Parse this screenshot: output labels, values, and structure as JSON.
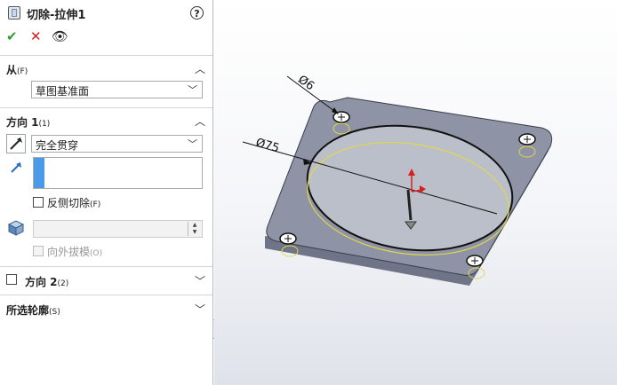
{
  "feature": {
    "title": "切除-拉伸1",
    "help_glyph": "?",
    "ok_glyph": "✔",
    "cancel_glyph": "✕",
    "preview_glyph": "👁"
  },
  "from": {
    "label": "从",
    "shortcut": "(F)",
    "value": "草图基准面"
  },
  "direction1": {
    "label": "方向 1",
    "shortcut": "(1)",
    "end_condition": "完全贯穿",
    "direction_input": "",
    "flip_side_label": "反侧切除",
    "flip_side_shortcut": "(F)",
    "draft_value": "",
    "draft_outward_label": "向外拔模",
    "draft_outward_shortcut": "(O)"
  },
  "direction2": {
    "label": "方向 2",
    "shortcut": "(2)"
  },
  "selected_contours": {
    "label": "所选轮廓",
    "shortcut": "(S)"
  },
  "model": {
    "dim_hole": "Ø6",
    "dim_circle": "Ø75",
    "plate_color": "#8e93a5",
    "face_color": "#babfc9",
    "sketch_color": "#e2d84a",
    "axis_x_color": "#d82020",
    "axis_y_color": "#d82020"
  }
}
